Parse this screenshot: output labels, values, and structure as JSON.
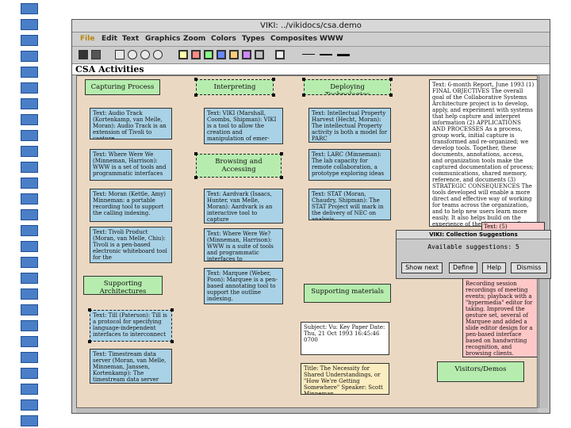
{
  "window": {
    "title": "VIKI: ../vikidocs/csa.demo"
  },
  "menu": [
    "File",
    "Edit",
    "Text",
    "Graphics",
    "Zoom",
    "Colors",
    "Types",
    "Composites",
    "WWW"
  ],
  "toolbar": {
    "icons": [
      "collection-icon",
      "list-icon",
      "square-icon",
      "rotate-left-icon",
      "rotate-right-icon",
      "refresh-icon"
    ],
    "colors": [
      "#ffffaa",
      "#ff8888",
      "#88ff88",
      "#6688ff",
      "#ffcc77",
      "#cc88ff",
      "#c0c0c0",
      "#eeeeee"
    ],
    "line_styles": [
      "thin-line",
      "medium-line",
      "thick-line"
    ]
  },
  "workspace": {
    "title": "CSA Activities"
  },
  "nodes": {
    "capturing_process": "Capturing Process",
    "interpreting": "Interpreting",
    "deploying_technologies": "Deploying Technologies",
    "browsing_accessing": "Browsing and Accessing",
    "supporting_architectures": "Supporting Architectures",
    "supporting_materials": "Supporting materials",
    "visitors_demos": "Visitors/Demos",
    "audio_track": "Text: Audio Track (Kortenkamp, van Melle, Moran): Audio Track is an extension of Tivoli to capture",
    "where_were_we": "Text: Where Were We (Minneman, Harrison): WWW is a set of tools and programmatic interfaces",
    "moran_kettle": "Text: Moran (Kettle, Amy) Minneman: a portable recording tool to support the calling indexing.",
    "tivoli_product": "Text: Tivoli Product (Moran, van Melle, Chiu): Tivoli is a pen-based electronic whiteboard tool for the",
    "viki": "Text: VIKI (Marshall, Coombs, Shipman): VIKI is a tool to allow the creation and manipulation of emer-",
    "aardvark": "Text: Aardvark (Isaacs, Hunter, van Melle, Moran): Aardvark is an interactive tool to capture",
    "where_were_we_2": "Text: Where Were We? (Minneman, Harrison): WWW is a suite of tools and programmatic interfaces to",
    "marquee": "Text: Marquee (Weber, Poon): Marquee is a pen-based annotating tool to support the outline indexing.",
    "ip_harvest": "Text: Intellectual Property Harvest (Hecht, Moran): The intellectual Property activity is both a model for PARC",
    "lanc": "Text: LARC (Minneman): The lab capacity for remote collaboration, a prototype exploring ideas",
    "stat": "Text: STAT (Moran, Chaudry, Shipman): The STAT Project will mark in the delivery of NEC on analysis",
    "till": "Text: Till (Paterson): Till is a protocol for specifying language-independent interfaces to interconnect",
    "timestream": "Text: Timestream data server (Moran, van Melle, Minneman, Janssen, Kortenkamp): The timestream data server will",
    "subject": "Subject: Vu: Key Paper Date: Thu, 21 Oct 1993 16:45:46 0700",
    "title_necessity": "Title: The Necessity for Shared Understandings, or \"How We're Getting Somewhere\" Speaker: Scott Minneman",
    "status_report": "Text: 6-month Report, June 1993 (1) FINAL OBJECTIVES The overall goal of the Collaborative Systems Architecture project is to develop, apply, and experiment with systems that help capture and interpret information (2) APPLICATIONS AND PROCESSES As a process, group work, initial capture is transformed and re-organized; we develop tools. Together, these documents, annotations, access, and organization tools make the captured documentation of process; communications, shared memory, reference, and documents (3) STRATEGIC CONSEQUENCES The tools developed will enable a more direct and effective way of working for teams across the organization, and to help new users learn more easily. It also helps build on the experience of the documents. Better reuse of work, activity on capture. Lessons in new kinds of documents",
    "accomplishments": "Text: (5) ACCOMPLISHMENTS",
    "pink_text": "Recording session recordings of meeting events; playback with a \"hypermedia\" editor for taking. Improved the gesture set, several of Marquee and added a slide editor design for a pen-based interface based on handwriting recognition, and browsing clients."
  },
  "dialog": {
    "title": "VIKI: Collection Suggestions",
    "available_label": "Available suggestions: 5",
    "buttons": [
      "Show next",
      "Define",
      "Help",
      "Dismiss"
    ]
  }
}
